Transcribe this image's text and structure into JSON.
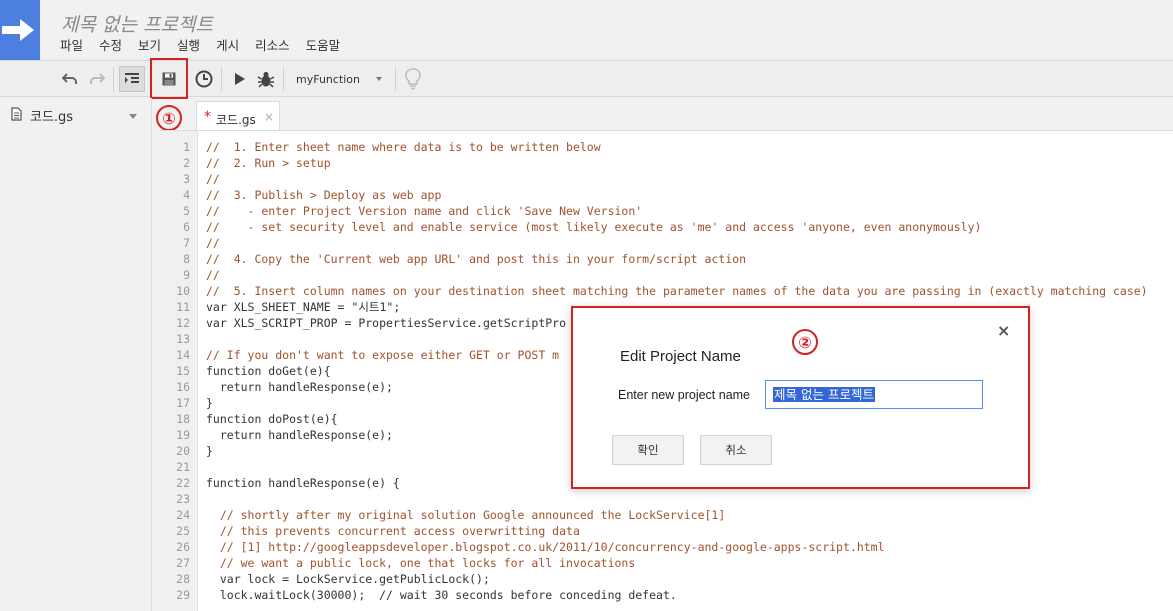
{
  "header": {
    "project_title": "제목 없는 프로젝트",
    "menu": [
      "파일",
      "수정",
      "보기",
      "실행",
      "게시",
      "리소스",
      "도움말"
    ]
  },
  "toolbar": {
    "function_select": "myFunction"
  },
  "sidebar": {
    "file_label": "코드.gs"
  },
  "markers": {
    "save": "①",
    "dialog": "②"
  },
  "tabs": [
    {
      "label": "코드.gs",
      "modified_mark": "*",
      "close": "×"
    }
  ],
  "editor": {
    "line_numbers": [
      "1",
      "2",
      "3",
      "4",
      "5",
      "6",
      "7",
      "8",
      "9",
      "10",
      "11",
      "12",
      "13",
      "14",
      "15",
      "16",
      "17",
      "18",
      "19",
      "20",
      "21",
      "22",
      "23",
      "24",
      "25",
      "26",
      "27",
      "28",
      "29"
    ],
    "lines": [
      "//  1. Enter sheet name where data is to be written below",
      "//  2. Run > setup",
      "//",
      "//  3. Publish > Deploy as web app",
      "//    - enter Project Version name and click 'Save New Version'",
      "//    - set security level and enable service (most likely execute as 'me' and access 'anyone, even anonymously)",
      "//",
      "//  4. Copy the 'Current web app URL' and post this in your form/script action",
      "//",
      "//  5. Insert column names on your destination sheet matching the parameter names of the data you are passing in (exactly matching case)",
      "var XLS_SHEET_NAME = \"시트1\";",
      "var XLS_SCRIPT_PROP = PropertiesService.getScriptPro",
      "",
      "// If you don't want to expose either GET or POST m",
      "function doGet(e){",
      "  return handleResponse(e);",
      "}",
      "function doPost(e){",
      "  return handleResponse(e);",
      "}",
      "",
      "function handleResponse(e) {",
      "",
      "  // shortly after my original solution Google announced the LockService[1]",
      "  // this prevents concurrent access overwritting data",
      "  // [1] http://googleappsdeveloper.blogspot.co.uk/2011/10/concurrency-and-google-apps-script.html",
      "  // we want a public lock, one that locks for all invocations",
      "  var lock = LockService.getPublicLock();",
      "  lock.waitLock(30000);  // wait 30 seconds before conceding defeat."
    ]
  },
  "dialog": {
    "title": "Edit Project Name",
    "close": "×",
    "label": "Enter new project name",
    "input_value": "제목 없는 프로젝트",
    "ok_label": "확인",
    "cancel_label": "취소"
  }
}
